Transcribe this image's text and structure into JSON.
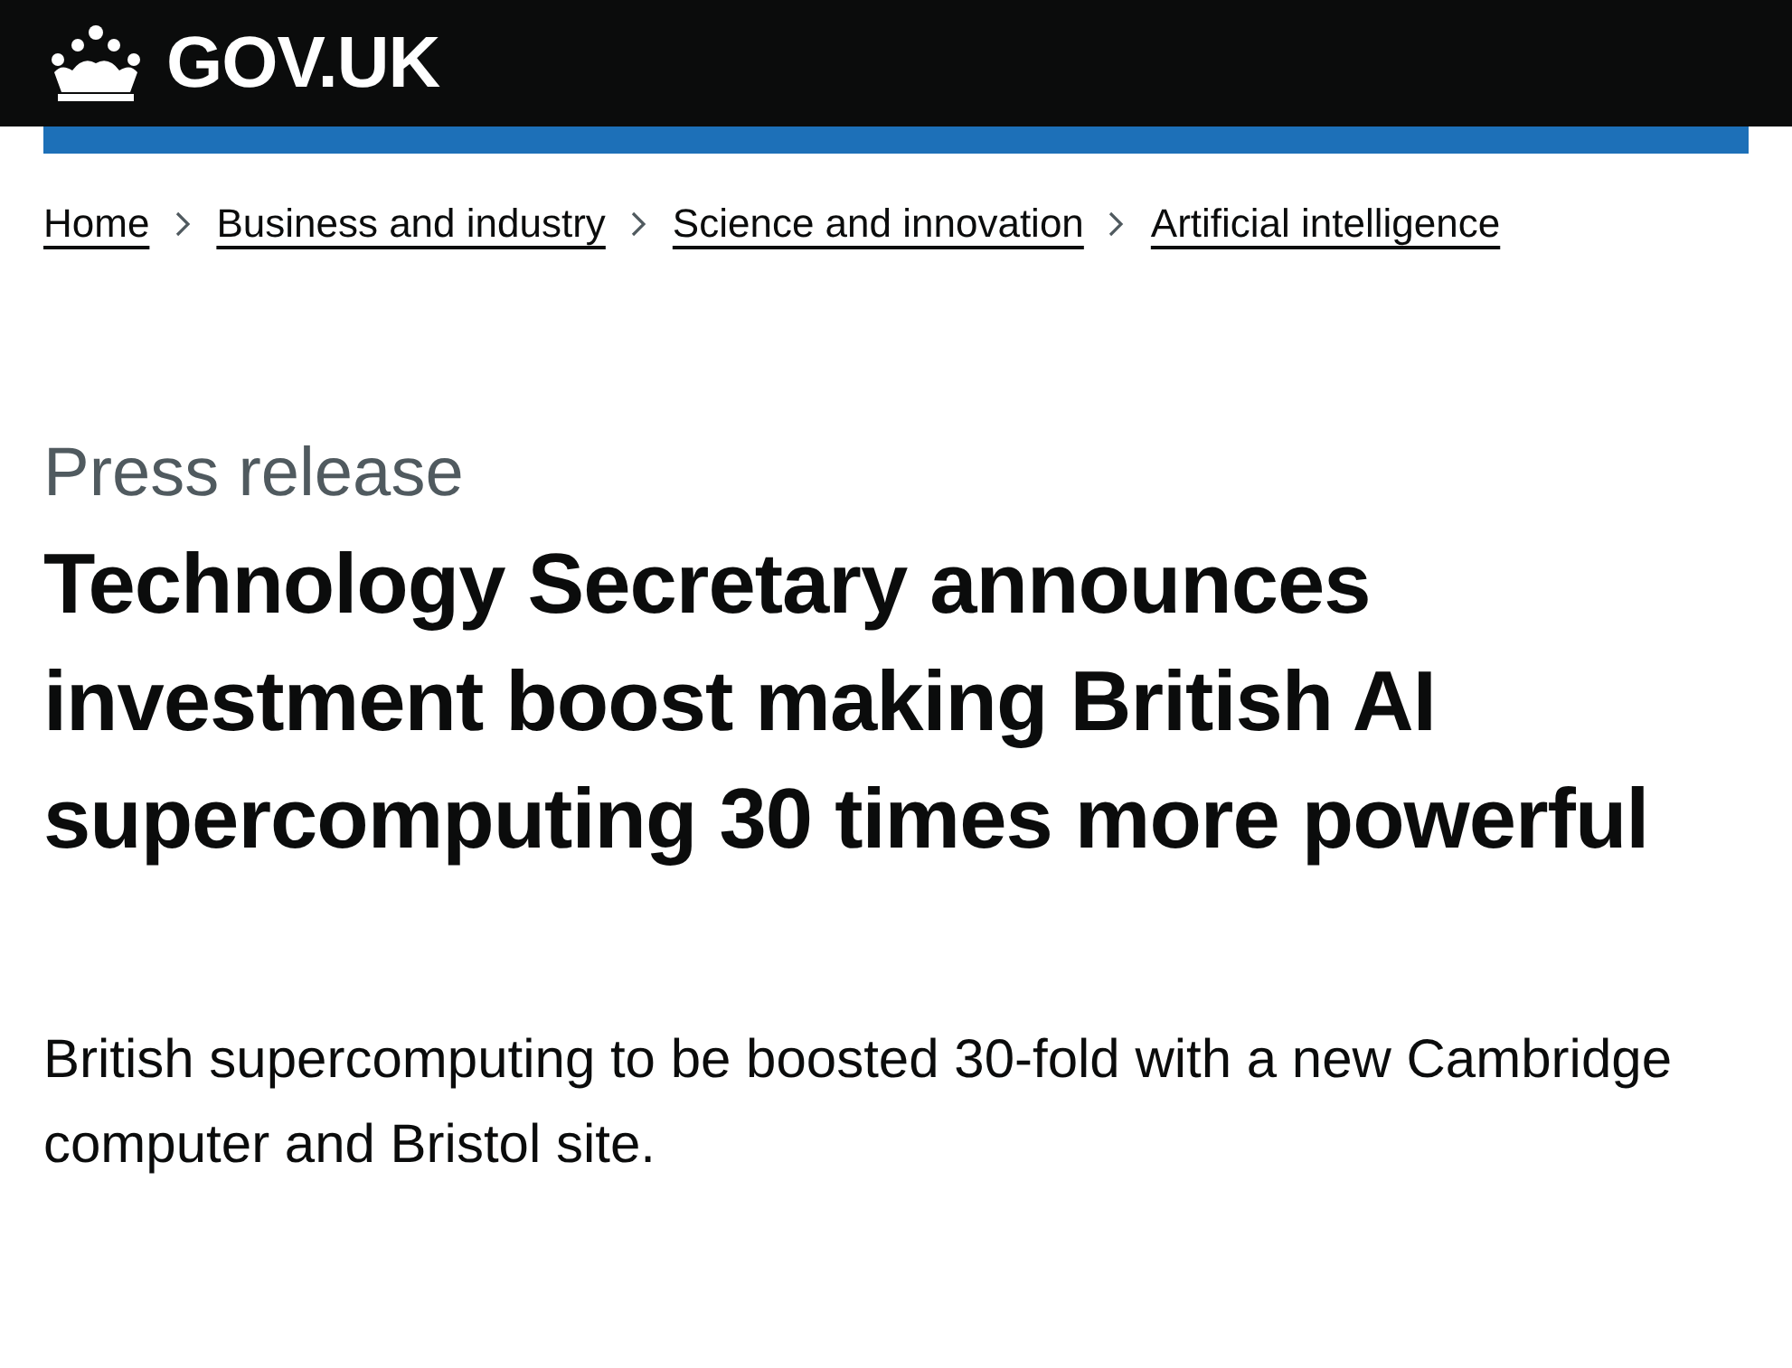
{
  "header": {
    "logo_text": "GOV.UK"
  },
  "breadcrumbs": [
    "Home",
    "Business and industry",
    "Science and innovation",
    "Artificial intelligence"
  ],
  "caption": "Press release",
  "title": "Technology Secretary announces investment boost making British AI supercomputing 30 times more powerful",
  "lead": "British supercomputing to be boosted 30-fold with a new Cambridge computer and Bristol site."
}
